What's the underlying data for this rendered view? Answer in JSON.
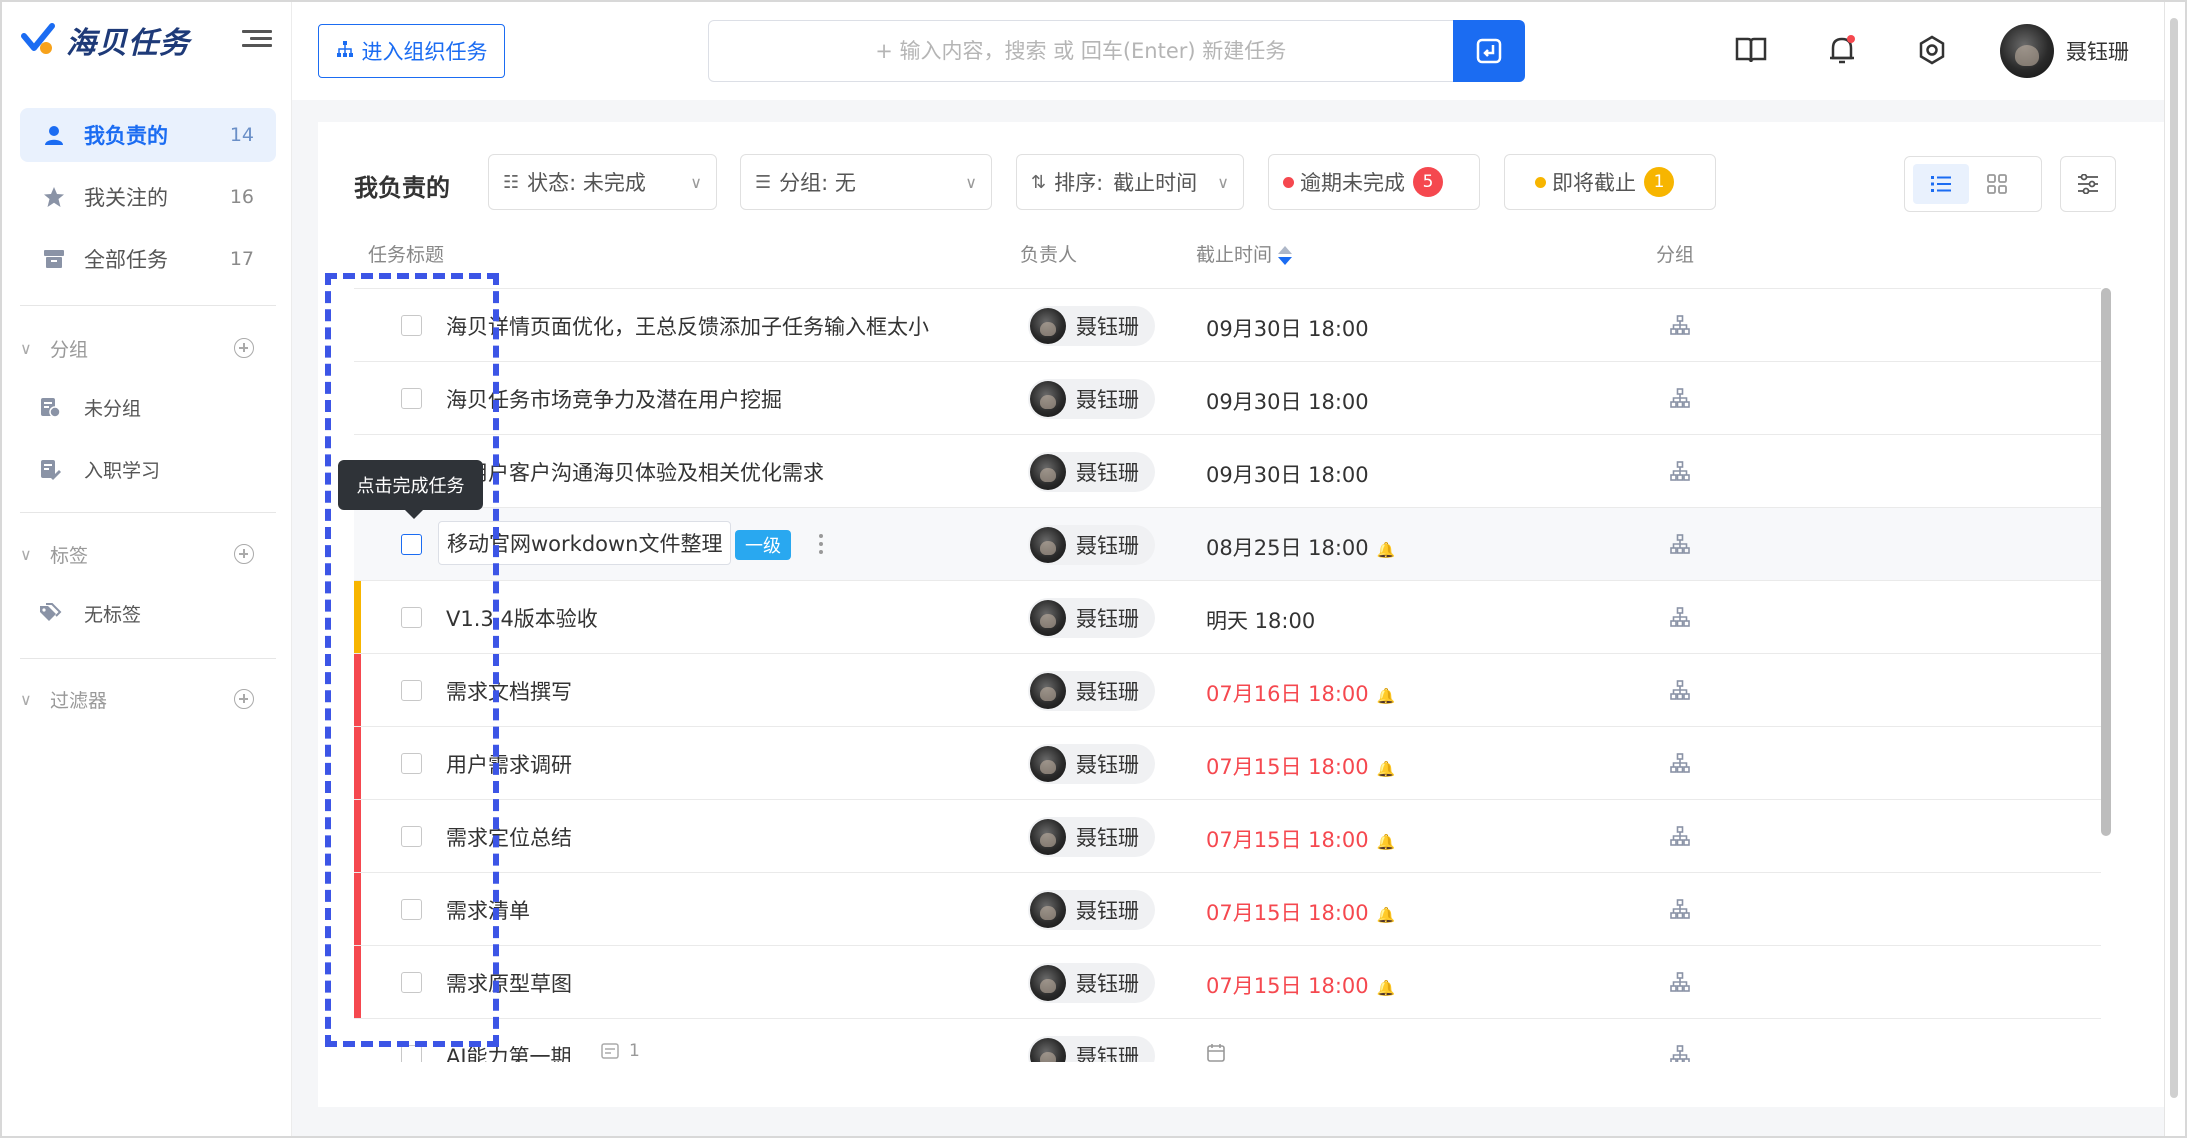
{
  "app": {
    "name": "海贝任务"
  },
  "sidebar": {
    "items": [
      {
        "label": "我负责的",
        "count": "14",
        "icon": "user-icon"
      },
      {
        "label": "我关注的",
        "count": "16",
        "icon": "star-icon"
      },
      {
        "label": "全部任务",
        "count": "17",
        "icon": "archive-icon"
      }
    ],
    "sections": {
      "group": {
        "label": "分组",
        "items": [
          "未分组",
          "入职学习"
        ]
      },
      "tag": {
        "label": "标签",
        "items": [
          "无标签"
        ]
      },
      "filter": {
        "label": "过滤器"
      }
    }
  },
  "header": {
    "org_button": "进入组织任务",
    "search_placeholder": "+ 输入内容，搜索 或 回车(Enter) 新建任务",
    "user_name": "聂钰珊"
  },
  "toolbar": {
    "title": "我负责的",
    "status": "状态: 未完成",
    "group": "分组: 无",
    "sort_prefix": "排序:",
    "sort_value": "截止时间",
    "overdue": {
      "label": "逾期未完成",
      "count": "5",
      "color": "#f5484f"
    },
    "due_soon": {
      "label": "即将截止",
      "count": "1",
      "color": "#f7b500"
    }
  },
  "columns": {
    "title": "任务标题",
    "assignee": "负责人",
    "due": "截止时间",
    "group": "分组"
  },
  "tooltip": "点击完成任务",
  "tasks": [
    {
      "title": "海贝详情页面优化，王总反馈添加子任务输入框太小",
      "assignee": "聂钰珊",
      "due": "09月30日 18:00",
      "overdue": false,
      "bar": ""
    },
    {
      "title": "海贝任务市场竞争力及潜在用户挖掘",
      "assignee": "聂钰珊",
      "due": "09月30日 18:00",
      "overdue": false,
      "bar": ""
    },
    {
      "title": "与用户客户沟通海贝体验及相关优化需求",
      "assignee": "聂钰珊",
      "due": "09月30日 18:00",
      "overdue": false,
      "bar": ""
    },
    {
      "title": "移动官网workdown文件整理",
      "assignee": "聂钰珊",
      "due": "08月25日 18:00",
      "overdue": false,
      "bar": "",
      "level": "一级"
    },
    {
      "title": "V1.3.4版本验收",
      "assignee": "聂钰珊",
      "due": "明天 18:00",
      "overdue": false,
      "bar": "#f7b500"
    },
    {
      "title": "需求文档撰写",
      "assignee": "聂钰珊",
      "due": "07月16日 18:00",
      "overdue": true,
      "bar": "#f5484f"
    },
    {
      "title": "用户需求调研",
      "assignee": "聂钰珊",
      "due": "07月15日 18:00",
      "overdue": true,
      "bar": "#f5484f"
    },
    {
      "title": "需求定位总结",
      "assignee": "聂钰珊",
      "due": "07月15日 18:00",
      "overdue": true,
      "bar": "#f5484f"
    },
    {
      "title": "需求清单",
      "assignee": "聂钰珊",
      "due": "07月15日 18:00",
      "overdue": true,
      "bar": "#f5484f"
    },
    {
      "title": "需求原型草图",
      "assignee": "聂钰珊",
      "due": "07月15日 18:00",
      "overdue": true,
      "bar": "#f5484f"
    },
    {
      "title": "AI能力第一期",
      "assignee": "聂钰珊",
      "due": "",
      "overdue": false,
      "bar": "",
      "subtasks": "1"
    }
  ],
  "colors": {
    "accent": "#1b6cf2",
    "overdue": "#f5484f",
    "warning": "#f7b500",
    "level_tag": "#29a8f0"
  }
}
